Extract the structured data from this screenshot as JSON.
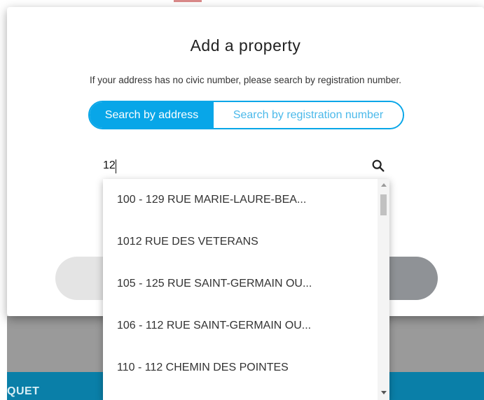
{
  "background": {
    "bottom_label": "QUET"
  },
  "modal": {
    "title": "Add a property",
    "hint": "If your address has no civic number, please search by registration number.",
    "tabs": [
      {
        "label": "Search by address",
        "active": true
      },
      {
        "label": "Search by registration number",
        "active": false
      }
    ],
    "search": {
      "value": "12",
      "icon": "search-icon"
    }
  },
  "dropdown": {
    "items": [
      "100 - 129 RUE MARIE-LAURE-BEA...",
      "1012 RUE DES VETERANS",
      "105 - 125 RUE SAINT-GERMAIN OU...",
      "106 - 112 RUE SAINT-GERMAIN OU...",
      "110 - 112 CHEMIN DES POINTES"
    ]
  },
  "colors": {
    "accent": "#08a6e8",
    "bg_blue": "#0a7fa8",
    "overlay_gray": "#9a9a9a"
  }
}
